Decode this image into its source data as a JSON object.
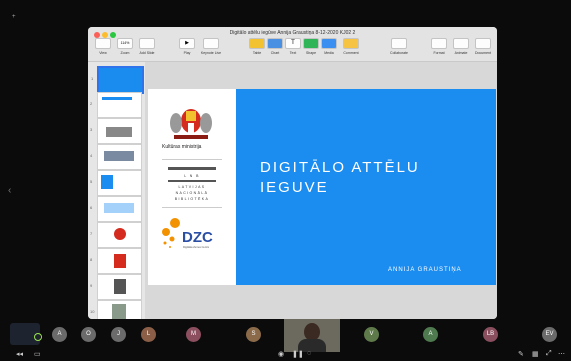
{
  "window": {
    "title": "Digitālo attēlu iegūve Annija Graustiņa 8-12-2020 KJ02 2"
  },
  "toolbar": {
    "view": "View",
    "zoom": "Zoom",
    "zoom_value": "114%",
    "add_slide": "Add Slide",
    "play": "Play",
    "keynote_live": "Keynote Live",
    "table": "Table",
    "chart": "Chart",
    "text": "Text",
    "shape": "Shape",
    "media": "Media",
    "comment": "Comment",
    "collaborate": "Collaborate",
    "format": "Format",
    "animate": "Animate",
    "document": "Document"
  },
  "navigator": {
    "slide_numbers": [
      "1",
      "2",
      "3",
      "4",
      "5",
      "6",
      "7",
      "8",
      "9",
      "10"
    ]
  },
  "slide": {
    "title_line1": "DIGITĀLO ATTĒLU",
    "title_line2": "IEGUVE",
    "author": "ANNIJA GRAUSTIŅA",
    "ministry": "Kultūras ministrija",
    "lnb_letters": "L   N   B",
    "lnb_line1": "LATVIJAS",
    "lnb_line2": "NACIONĀLĀ",
    "lnb_line3": "BIBLIOTĒKA",
    "dzc": "DZC",
    "dzc_sub": "Digitālās Zemes Centrs"
  },
  "participants": [
    {
      "initial": "A",
      "color": "#6b6b6b"
    },
    {
      "initial": "O",
      "color": "#6b6b6b"
    },
    {
      "initial": "J",
      "color": "#6b6b6b"
    },
    {
      "initial": "L",
      "color": "#8b5e47"
    },
    {
      "initial": "M",
      "color": "#8c4f5f"
    },
    {
      "initial": "S",
      "color": "#8b6a4a"
    },
    {
      "initial": "V",
      "color": "#5f7a4a"
    },
    {
      "initial": "A",
      "color": "#4f7a4f"
    },
    {
      "initial": "LB",
      "color": "#8a4f5f"
    },
    {
      "initial": "EV",
      "color": "#6b6b6b"
    }
  ],
  "colors": {
    "slide_blue": "#1b8cf0",
    "selection": "#2f74ea",
    "red": "#d52b1e",
    "orange": "#f39200"
  }
}
